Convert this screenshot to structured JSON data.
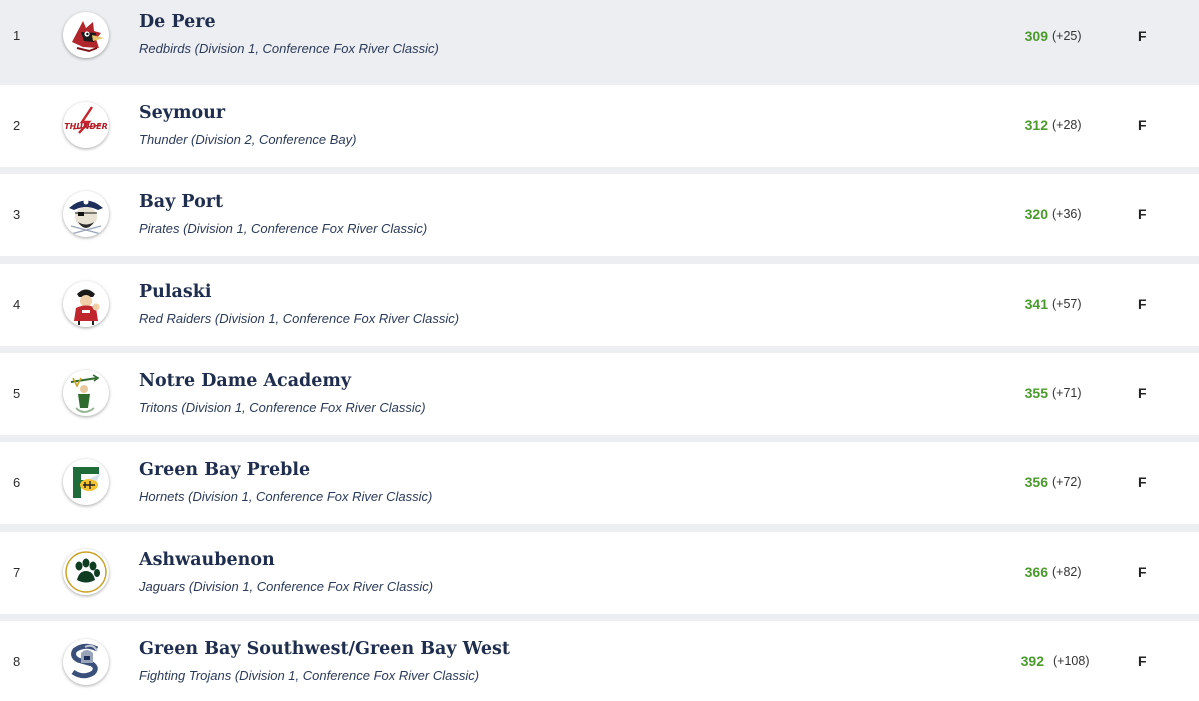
{
  "colors": {
    "score_green": "#4a9a2c",
    "name_navy": "#1f2d4e",
    "highlight_row": "#eceef1"
  },
  "rows": [
    {
      "rank": "1",
      "name": "De Pere",
      "subtitle": "Redbirds (Division 1, Conference Fox River Classic)",
      "score": "309",
      "diff": "(+25)",
      "status": "F",
      "logo": "cardinal-logo-icon"
    },
    {
      "rank": "2",
      "name": "Seymour",
      "subtitle": "Thunder (Division 2, Conference Bay)",
      "score": "312",
      "diff": "(+28)",
      "status": "F",
      "logo": "thunder-logo-icon",
      "logo_text": "THUNDER"
    },
    {
      "rank": "3",
      "name": "Bay Port",
      "subtitle": "Pirates (Division 1, Conference Fox River Classic)",
      "score": "320",
      "diff": "(+36)",
      "status": "F",
      "logo": "pirate-logo-icon"
    },
    {
      "rank": "4",
      "name": "Pulaski",
      "subtitle": "Red Raiders (Division 1, Conference Fox River Classic)",
      "score": "341",
      "diff": "(+57)",
      "status": "F",
      "logo": "red-raider-logo-icon"
    },
    {
      "rank": "5",
      "name": "Notre Dame Academy",
      "subtitle": "Tritons (Division 1, Conference Fox River Classic)",
      "score": "355",
      "diff": "(+71)",
      "status": "F",
      "logo": "triton-logo-icon"
    },
    {
      "rank": "6",
      "name": "Green Bay Preble",
      "subtitle": "Hornets (Division 1, Conference Fox River Classic)",
      "score": "356",
      "diff": "(+72)",
      "status": "F",
      "logo": "hornet-logo-icon"
    },
    {
      "rank": "7",
      "name": "Ashwaubenon",
      "subtitle": "Jaguars (Division 1, Conference Fox River Classic)",
      "score": "366",
      "diff": "(+82)",
      "status": "F",
      "logo": "paw-print-logo-icon"
    },
    {
      "rank": "8",
      "name": "Green Bay Southwest/Green Bay West",
      "subtitle": "Fighting Trojans (Division 1, Conference Fox River Classic)",
      "score": "392",
      "diff": "(+108)",
      "status": "F",
      "logo": "trojan-logo-icon"
    }
  ]
}
